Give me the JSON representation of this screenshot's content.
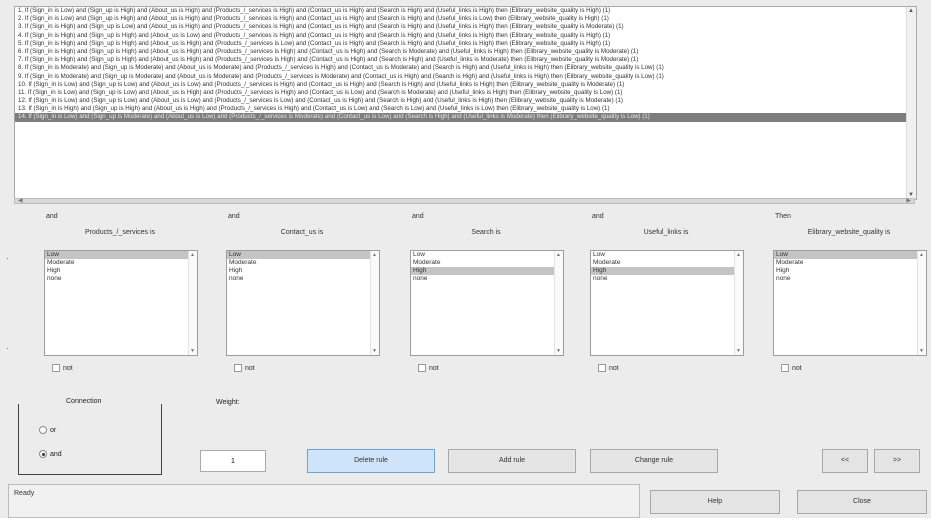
{
  "rules": [
    "1. If (Sign_in is Low) and (Sign_up is High) and (About_us is High) and (Products_/_services is High) and (Contact_us is High) and (Search is High) and (Useful_links is High) then (Elibrary_website_quality is High) (1)",
    "2. If (Sign_in is Low) and (Sign_up is High) and (About_us is High) and (Products_/_services is High) and (Contact_us is High) and (Search is High) and (Useful_links is Low) then (Elibrary_website_quality is High) (1)",
    "3. If (Sign_in is High) and (Sign_up is Low) and (About_us is High) and (Products_/_services is High) and (Contact_us is High) and (Search is High) and (Useful_links is High) then (Elibrary_website_quality is Moderate) (1)",
    "4. If (Sign_in is High) and (Sign_up is High) and (About_us is Low) and (Products_/_services is High) and (Contact_us is High) and (Search is High) and (Useful_links is High) then (Elibrary_website_quality is High) (1)",
    "5. If (Sign_in is High) and (Sign_up is High) and (About_us is High) and (Products_/_services is Low) and (Contact_us is High) and (Search is High) and (Useful_links is High) then (Elibrary_website_quality is High) (1)",
    "6. If (Sign_in is High) and (Sign_up is High) and (About_us is High) and (Products_/_services is High) and (Contact_us is High) and (Search is Moderate) and (Useful_links is High) then (Elibrary_website_quality is Moderate) (1)",
    "7. If (Sign_in is High) and (Sign_up is High) and (About_us is High) and (Products_/_services is High) and (Contact_us is High) and (Search is High) and (Useful_links is Moderate) then (Elibrary_website_quality is Moderate) (1)",
    "8. If (Sign_in is Moderate) and (Sign_up is Moderate) and (About_us is Moderate) and (Products_/_services is High) and (Contact_us is Moderate) and (Search is High) and (Useful_links is High) then (Elibrary_website_quality is Low) (1)",
    "9. If (Sign_in is Moderate) and (Sign_up is Moderate) and (About_us is Moderate) and (Products_/_services is Moderate) and (Contact_us is High) and (Search is High) and (Useful_links is High) then (Elibrary_website_quality is Low) (1)",
    "10. If (Sign_in is Low) and (Sign_up is Low) and (About_us is Low) and (Products_/_services is High) and (Contact_us is High) and (Search is High) and (Useful_links is High) then (Elibrary_website_quality is Moderate) (1)",
    "11. If (Sign_in is Low) and (Sign_up is Low) and (About_us is High) and (Products_/_services is High) and (Contact_us is Low) and (Search is Moderate) and (Useful_links is High) then (Elibrary_website_quality is Low) (1)",
    "12. If (Sign_in is Low) and (Sign_up is Low) and (About_us is Low) and (Products_/_services is Low) and (Contact_us is High) and (Search is High) and (Useful_links is High) then (Elibrary_website_quality is Moderate) (1)",
    "13. If (Sign_in is High) and (Sign_up is High) and (About_us is High) and (Products_/_services is High) and (Contact_us is Low) and (Search is Low) and (Useful_links is Low) then (Elibrary_website_quality is Low) (1)",
    "14. If (Sign_in is Low) and (Sign_up is Moderate) and (About_us is Low) and (Products_/_services is Moderate) and (Contact_us is Low) and (Search is High) and (Useful_links is Moderate) then (Elibrary_website_quality is Low) (1)"
  ],
  "selected_rule": 13,
  "columns": [
    {
      "conj": "and",
      "var": "Products_/_services is",
      "options": [
        "Low",
        "Moderate",
        "High",
        "none"
      ],
      "selected": 0,
      "not_label": "not"
    },
    {
      "conj": "and",
      "var": "Contact_us is",
      "options": [
        "Low",
        "Moderate",
        "High",
        "none"
      ],
      "selected": 0,
      "not_label": "not"
    },
    {
      "conj": "and",
      "var": "Search is",
      "options": [
        "Low",
        "Moderate",
        "High",
        "none"
      ],
      "selected": 2,
      "not_label": "not"
    },
    {
      "conj": "and",
      "var": "Useful_links is",
      "options": [
        "Low",
        "Moderate",
        "High",
        "none"
      ],
      "selected": 2,
      "not_label": "not"
    },
    {
      "conj": "Then",
      "var": "Elibrary_website_quality is",
      "options": [
        "Low",
        "Moderate",
        "High",
        "none"
      ],
      "selected": 0,
      "not_label": "not"
    }
  ],
  "connection": {
    "title": "Connection",
    "or_label": "or",
    "and_label": "and",
    "selected": "and"
  },
  "weight": {
    "label": "Weight:",
    "value": "1"
  },
  "buttons": {
    "delete": "Delete rule",
    "add": "Add rule",
    "change": "Change rule",
    "prev": "<<",
    "next": ">>",
    "help": "Help",
    "close": "Close"
  },
  "status": "Ready",
  "colors": {
    "selected_rule_bg": "#7d7d7d",
    "hot_button_bg": "#cfe4f8"
  }
}
